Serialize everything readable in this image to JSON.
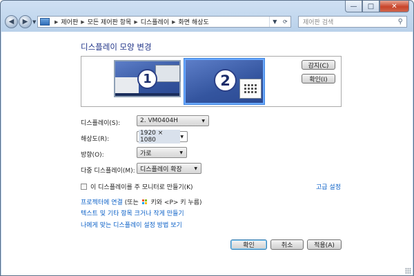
{
  "window": {
    "caption": {
      "minimize": "—",
      "maximize": "□",
      "close": "✕"
    }
  },
  "nav": {
    "back": "◀",
    "forward": "▶",
    "history": "▼",
    "breadcrumbs": [
      "제어판",
      "모든 제어판 항목",
      "디스플레이",
      "화면 해상도"
    ],
    "search_placeholder": "제어판 검색"
  },
  "main": {
    "title": "디스플레이 모양 변경",
    "monitors": [
      {
        "number": "1",
        "selected": false
      },
      {
        "number": "2",
        "selected": true
      }
    ],
    "detect_button": "감지(C)",
    "identify_button": "확인(I)",
    "fields": {
      "display": {
        "label": "디스플레이(S):",
        "value": "2. VM0404H"
      },
      "resolution": {
        "label": "해상도(R):",
        "value": "1920 × 1080"
      },
      "orientation": {
        "label": "방향(O):",
        "value": "가로"
      },
      "multiple": {
        "label": "다중 디스플레이(M):",
        "value": "디스플레이 확장"
      }
    },
    "main_monitor_checkbox": {
      "label": "이 디스플레이를 주 모니터로 만들기(K)",
      "checked": false
    },
    "advanced_link": "고급 설정",
    "links": {
      "projector_link": "프로젝터에 연결",
      "projector_hint_pre": " (또는 ",
      "projector_hint_post": " 키와 <P> 키 누름)",
      "text_size_link": "텍스트 및 기타 항목 크거나 작게 만들기",
      "help_link": "나에게 맞는 디스플레이 설정 방법 보기"
    },
    "buttons": {
      "ok": "확인",
      "cancel": "취소",
      "apply": "적용(A)"
    }
  },
  "colors": {
    "link": "#0b60c7",
    "title": "#1e3287",
    "monitor": "#34559f"
  }
}
